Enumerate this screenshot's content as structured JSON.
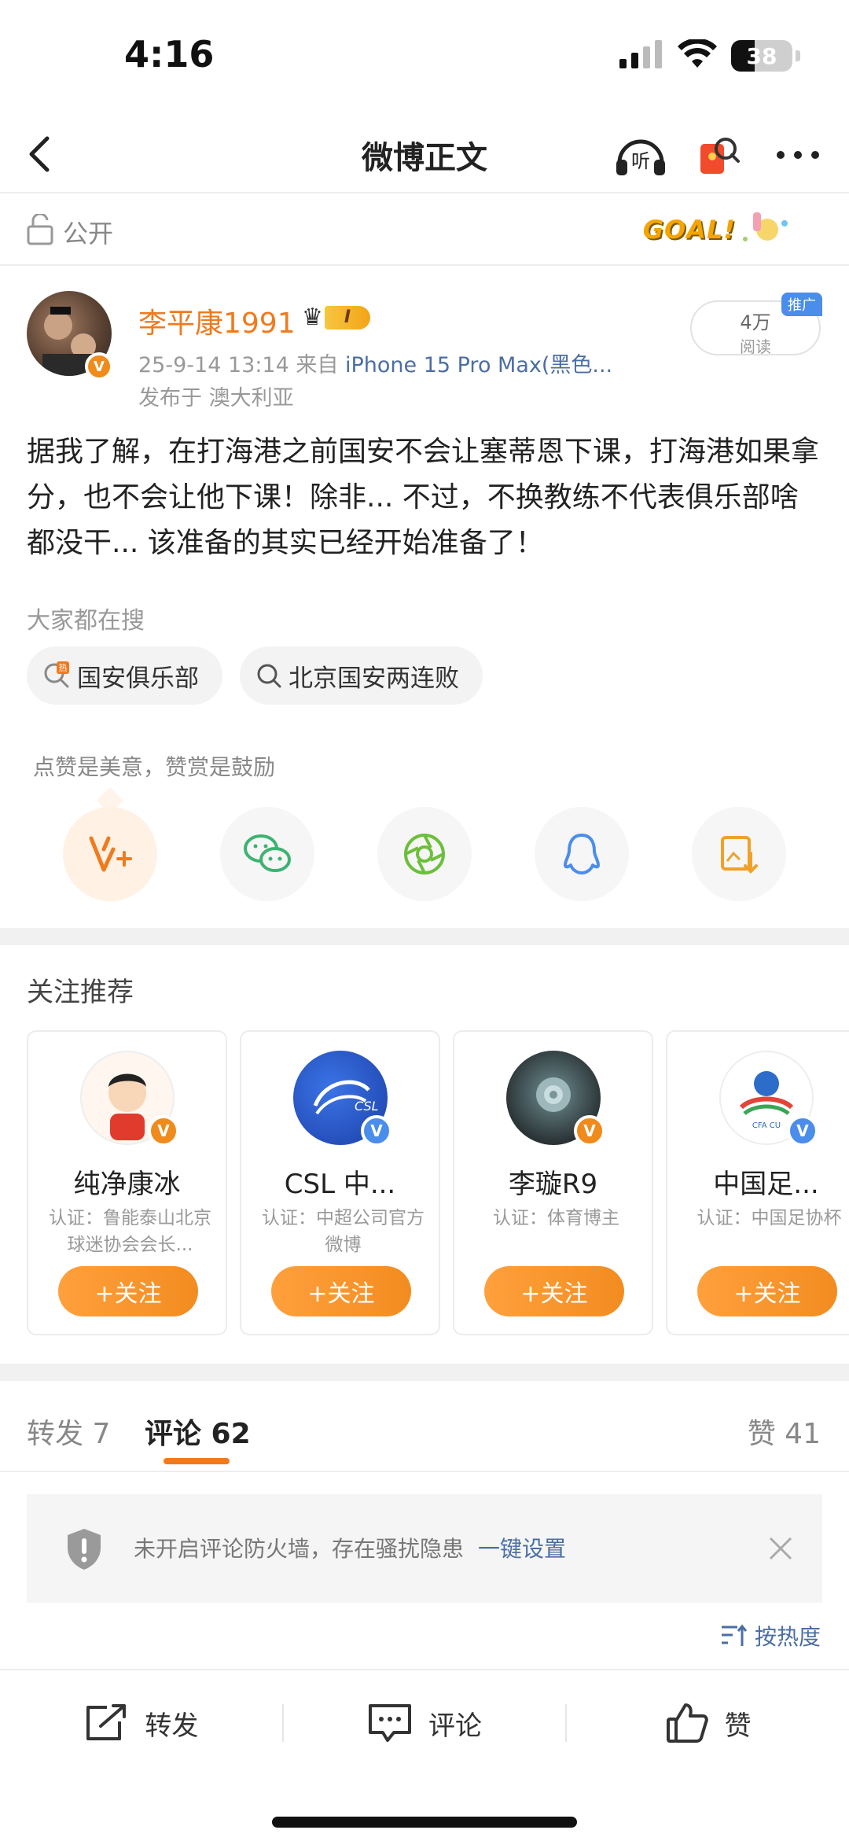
{
  "status_bar": {
    "time": "4:16",
    "battery": "38"
  },
  "nav": {
    "title": "微博正文"
  },
  "visibility": {
    "label": "公开",
    "badge_text": "GOAL!"
  },
  "post": {
    "username": "李平康1991",
    "vip_level": "I",
    "date": "25-9-14 13:14",
    "source_prefix": "来自",
    "device": "iPhone 15 Pro Max(黑色...",
    "location": "发布于 澳大利亚",
    "views": "4万",
    "views_label": "阅读",
    "promo_tag": "推广",
    "body": "据我了解，在打海港之前国安不会让塞蒂恩下课，打海港如果拿分，也不会让他下课！除非... 不过，不换教练不代表俱乐部啥都没干... 该准备的其实已经开始准备了！"
  },
  "hot_search": {
    "title": "大家都在搜",
    "items": [
      {
        "label": "国安俱乐部",
        "icon": "hot-search-icon"
      },
      {
        "label": "北京国安两连败",
        "icon": "search-icon"
      }
    ]
  },
  "reward": {
    "text": "点赞是美意，赞赏是鼓励",
    "buttons": [
      "reward-icon",
      "wechat-icon",
      "moments-icon",
      "qq-icon",
      "save-image-icon"
    ]
  },
  "recommend": {
    "title": "关注推荐",
    "users": [
      {
        "name": "纯净康冰",
        "cert": "认证：鲁能泰山北京球迷协会会长...",
        "follow": "+关注",
        "badge_color": "#f08a1b"
      },
      {
        "name": "CSL 中...",
        "cert": "认证：中超公司官方微博",
        "follow": "+关注",
        "badge_color": "#4b8dea"
      },
      {
        "name": "李璇R9",
        "cert": "认证：体育博主",
        "follow": "+关注",
        "badge_color": "#f08a1b"
      },
      {
        "name": "中国足...",
        "cert": "认证：中国足协杯",
        "follow": "+关注",
        "badge_color": "#4b8dea"
      }
    ]
  },
  "tabs": {
    "repost": "转发 7",
    "comment": "评论 62",
    "like": "赞 41"
  },
  "firewall": {
    "text": "未开启评论防火墙，存在骚扰隐患",
    "link": "一键设置"
  },
  "sort": {
    "label": "按热度"
  },
  "bottom_bar": {
    "repost": "转发",
    "comment": "评论",
    "like": "赞"
  },
  "colors": {
    "accent": "#f07a1e",
    "link": "#4b6ea3"
  }
}
